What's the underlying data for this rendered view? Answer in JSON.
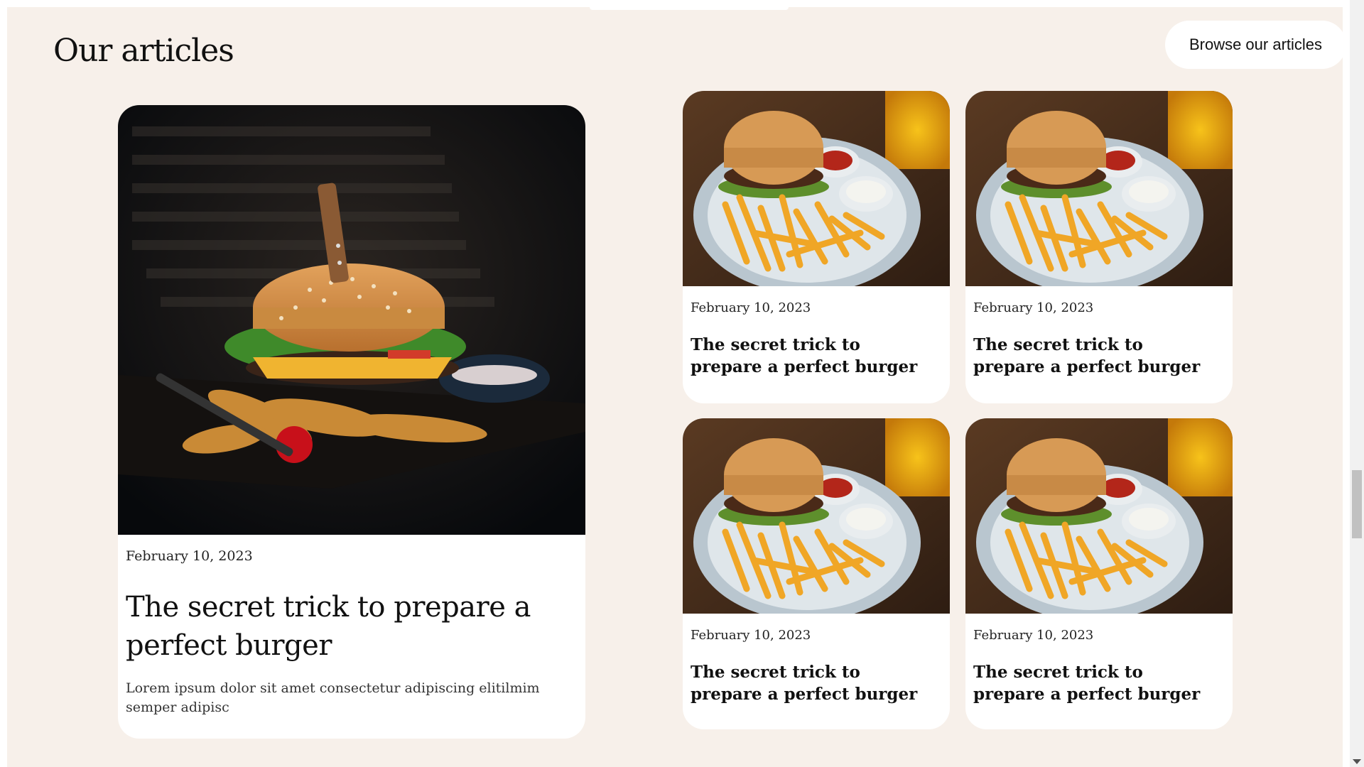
{
  "section": {
    "title": "Our articles",
    "browse_label": "Browse our articles"
  },
  "featured": {
    "date": "February 10, 2023",
    "title": "The secret trick to prepare a perfect burger",
    "excerpt": "Lorem ipsum dolor sit amet consectetur adipiscing elitilmim semper adipisc",
    "image": "burger-with-knife-photo"
  },
  "articles": [
    {
      "date": "February 10, 2023",
      "title": "The secret trick to prepare a perfect burger",
      "image": "burger-and-fries-photo"
    },
    {
      "date": "February 10, 2023",
      "title": "The secret trick to prepare a perfect burger",
      "image": "burger-and-fries-photo"
    },
    {
      "date": "February 10, 2023",
      "title": "The secret trick to prepare a perfect burger",
      "image": "burger-and-fries-photo"
    },
    {
      "date": "February 10, 2023",
      "title": "The secret trick to prepare a perfect burger",
      "image": "burger-and-fries-photo"
    }
  ],
  "colors": {
    "background": "#f7f0ea",
    "card": "#ffffff",
    "text": "#111111"
  }
}
